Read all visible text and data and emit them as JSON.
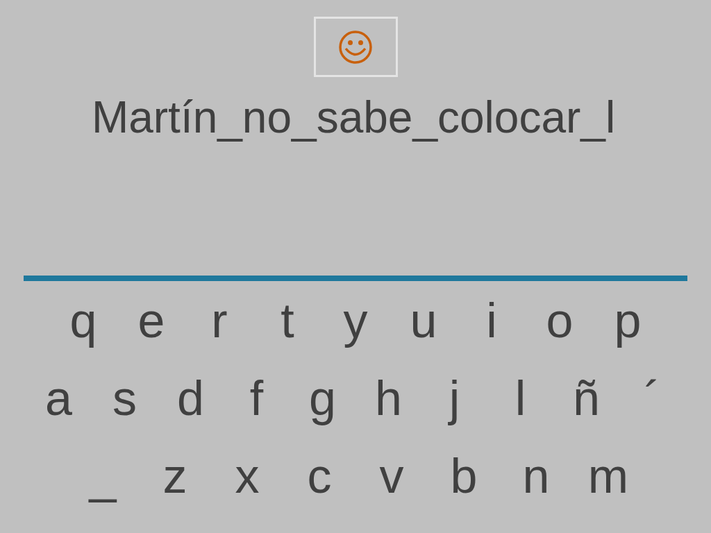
{
  "hint_box": {
    "kind": "smiley"
  },
  "phrase": "Martín_no_sabe_colocar_l",
  "keyboard": {
    "rows": [
      [
        "q",
        "e",
        "r",
        "t",
        "y",
        "u",
        "i",
        "o",
        "p"
      ],
      [
        "a",
        "s",
        "d",
        "f",
        "g",
        "h",
        "j",
        "l",
        "ñ",
        "´"
      ],
      [
        "_",
        "z",
        "x",
        "c",
        "v",
        "b",
        "n",
        "m"
      ]
    ]
  }
}
